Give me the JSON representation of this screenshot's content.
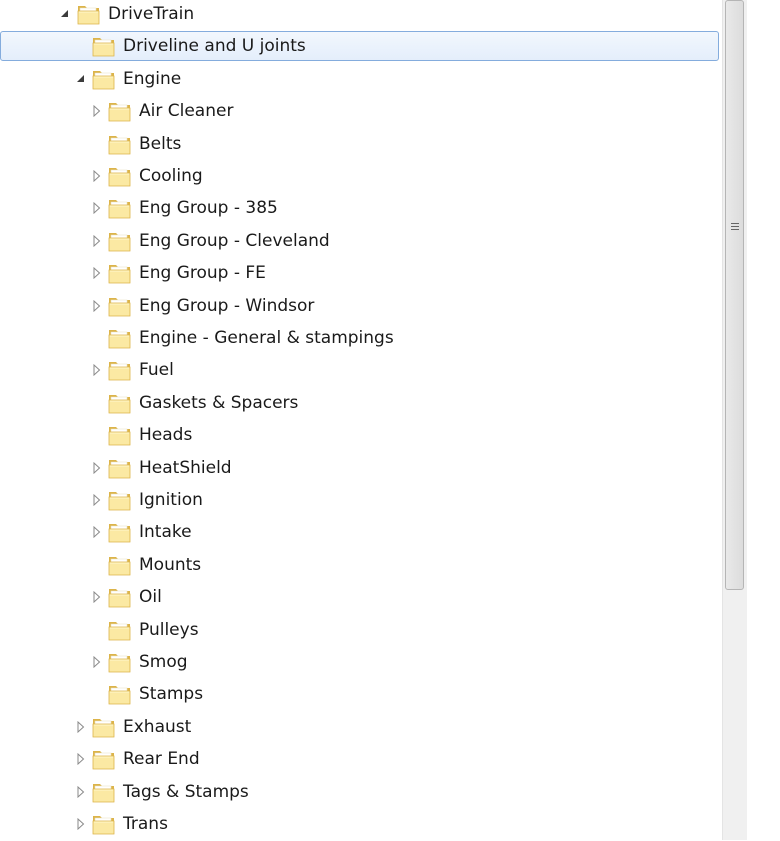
{
  "tree": {
    "items": [
      {
        "label": "DriveTrain",
        "level": 0,
        "expander": "expanded"
      },
      {
        "label": "Driveline and U joints",
        "level": 1,
        "expander": "none",
        "selected": true
      },
      {
        "label": "Engine",
        "level": 1,
        "expander": "expanded"
      },
      {
        "label": "Air Cleaner",
        "level": 2,
        "expander": "collapsed"
      },
      {
        "label": "Belts",
        "level": 2,
        "expander": "none"
      },
      {
        "label": "Cooling",
        "level": 2,
        "expander": "collapsed"
      },
      {
        "label": "Eng Group - 385",
        "level": 2,
        "expander": "collapsed"
      },
      {
        "label": "Eng Group - Cleveland",
        "level": 2,
        "expander": "collapsed"
      },
      {
        "label": "Eng Group - FE",
        "level": 2,
        "expander": "collapsed"
      },
      {
        "label": "Eng Group - Windsor",
        "level": 2,
        "expander": "collapsed"
      },
      {
        "label": "Engine - General & stampings",
        "level": 2,
        "expander": "none"
      },
      {
        "label": "Fuel",
        "level": 2,
        "expander": "collapsed"
      },
      {
        "label": "Gaskets & Spacers",
        "level": 2,
        "expander": "none"
      },
      {
        "label": "Heads",
        "level": 2,
        "expander": "none"
      },
      {
        "label": "HeatShield",
        "level": 2,
        "expander": "collapsed"
      },
      {
        "label": "Ignition",
        "level": 2,
        "expander": "collapsed"
      },
      {
        "label": "Intake",
        "level": 2,
        "expander": "collapsed"
      },
      {
        "label": "Mounts",
        "level": 2,
        "expander": "none"
      },
      {
        "label": "Oil",
        "level": 2,
        "expander": "collapsed"
      },
      {
        "label": "Pulleys",
        "level": 2,
        "expander": "none"
      },
      {
        "label": "Smog",
        "level": 2,
        "expander": "collapsed"
      },
      {
        "label": "Stamps",
        "level": 2,
        "expander": "none"
      },
      {
        "label": "Exhaust",
        "level": 1,
        "expander": "collapsed"
      },
      {
        "label": "Rear End",
        "level": 1,
        "expander": "collapsed"
      },
      {
        "label": "Tags & Stamps",
        "level": 1,
        "expander": "collapsed"
      },
      {
        "label": "Trans",
        "level": 1,
        "expander": "collapsed"
      }
    ]
  },
  "scrollbar": {
    "thumb_position": 0.0,
    "visible_fraction": 0.7
  },
  "colors": {
    "selection_border": "#84acdd",
    "selection_fill": "#e4eefb",
    "folder_light": "#fbe9a3",
    "folder_dark": "#dcb44a",
    "expander_stroke": "#8a8a8a",
    "expanded_fill": "#3c3c3c"
  }
}
